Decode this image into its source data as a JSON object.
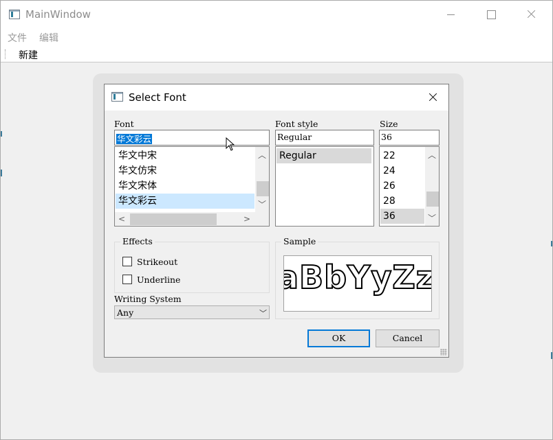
{
  "window": {
    "title": "MainWindow",
    "menu": [
      "文件",
      "编辑"
    ],
    "toolbar_new": "新建"
  },
  "dialog": {
    "title": "Select Font",
    "font": {
      "label": "Font",
      "value": "华文彩云",
      "items": [
        "华文中宋",
        "华文仿宋",
        "华文宋体",
        "华文彩云"
      ],
      "selected": "华文彩云"
    },
    "style": {
      "label": "Font style",
      "value": "Regular",
      "items": [
        "Regular"
      ],
      "selected": "Regular"
    },
    "size": {
      "label": "Size",
      "value": "36",
      "items": [
        "22",
        "24",
        "26",
        "28",
        "36"
      ],
      "selected": "36"
    },
    "effects": {
      "label": "Effects",
      "strikeout": "Strikeout",
      "underline": "Underline"
    },
    "writing_system": {
      "label": "Writing System",
      "value": "Any"
    },
    "sample": {
      "label": "Sample",
      "text": "aBbYyZz"
    },
    "buttons": {
      "ok": "OK",
      "cancel": "Cancel"
    }
  },
  "colors": {
    "selection_blue": "#0078d7",
    "list_highlight": "#cce8ff",
    "list_selected_gray": "#d9d9d9"
  }
}
